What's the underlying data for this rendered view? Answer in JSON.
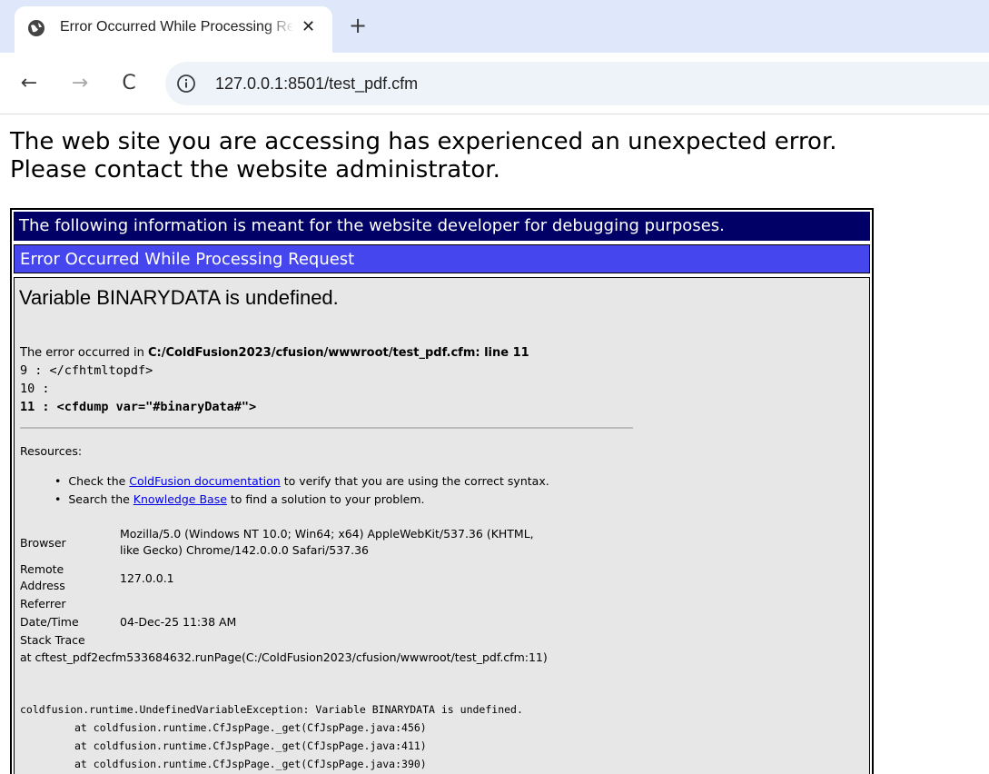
{
  "browser": {
    "tab": {
      "title": "Error Occurred While Processing Request",
      "close_glyph": "✕",
      "favicon": "globe-icon"
    },
    "new_tab_glyph": "+",
    "nav": {
      "back": "←",
      "forward": "→",
      "reload": "C"
    },
    "url": "127.0.0.1:8501/test_pdf.cfm"
  },
  "page": {
    "headline": [
      "The web site you are accessing has experienced an unexpected error.",
      "Please contact the website administrator."
    ],
    "debug_banner": "The following information is meant for the website developer for debugging purposes.",
    "error_banner": "Error Occurred While Processing Request",
    "error_message": "Variable BINARYDATA is undefined.",
    "location_prefix": "The error occurred in ",
    "location_path": "C:/ColdFusion2023/cfusion/wwwroot/test_pdf.cfm: line 11",
    "code_lines": [
      "9 : </cfhtmltopdf>",
      "10 :",
      "11 : <cfdump var=\"#binaryData#\">"
    ],
    "resources_label": "Resources:",
    "bullets": [
      {
        "pre": "Check the ",
        "link": "ColdFusion documentation",
        "post": " to verify that you are using the correct syntax."
      },
      {
        "pre": "Search the ",
        "link": "Knowledge Base",
        "post": " to find a solution to your problem."
      }
    ],
    "info": {
      "browser_label": "Browser",
      "browser_value": [
        "Mozilla/5.0 (Windows NT 10.0; Win64; x64) AppleWebKit/537.36 (KHTML,",
        "like Gecko) Chrome/142.0.0.0 Safari/537.36"
      ],
      "remote_label": [
        "Remote",
        "Address"
      ],
      "remote_value": "127.0.0.1",
      "referrer_label": "Referrer",
      "datetime_label": "Date/Time",
      "datetime_value": "04-Dec-25 11:38 AM",
      "stack_label": "Stack Trace"
    },
    "trace_line": "at cftest_pdf2ecfm533684632.runPage(C:/ColdFusion2023/cfusion/wwwroot/test_pdf.cfm:11)",
    "java_trace": [
      "coldfusion.runtime.UndefinedVariableException: Variable BINARYDATA is undefined.",
      "\tat coldfusion.runtime.CfJspPage._get(CfJspPage.java:456)",
      "\tat coldfusion.runtime.CfJspPage._get(CfJspPage.java:411)",
      "\tat coldfusion.runtime.CfJspPage._get(CfJspPage.java:390)"
    ]
  }
}
